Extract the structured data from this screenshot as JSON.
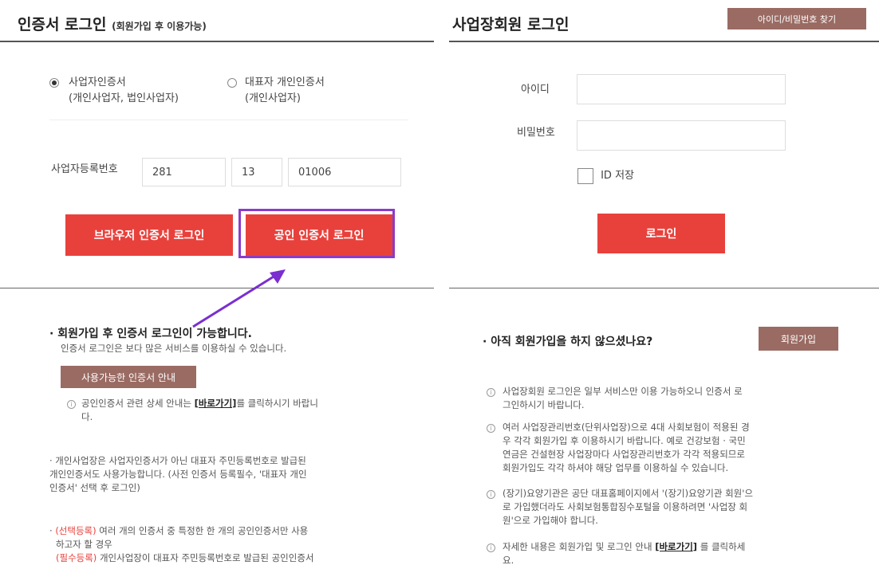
{
  "left": {
    "title": "인증서 로그인",
    "subtitle": "(회원가입 후 이용가능)",
    "radio1": {
      "line1": "사업자인증서",
      "line2": "(개인사업자, 법인사업자)"
    },
    "radio2": {
      "line1": "대표자 개인인증서",
      "line2": "(개인사업자)"
    },
    "bizno_label": "사업자등록번호",
    "bizno": [
      "281",
      "13",
      "01006"
    ],
    "btn_browser": "브라우저 인증서 로그인",
    "btn_public": "공인 인증서 로그인",
    "notice_title": "· 회원가입 후 인증서 로그인이 가능합니다.",
    "notice_sub": "인증서 로그인은 보다 많은 서비스를 이용하실 수 있습니다.",
    "cert_guide_btn": "사용가능한 인증서 안내",
    "info1_a": "공인인증서 관련 상세 안내는 ",
    "info1_link": "[바로가기]",
    "info1_b": "를 클릭하시기 바랍니",
    "info1_c": "다.",
    "info2_l1": "· 개인사업장은 사업자인증서가 아닌 대표자 주민등록번호로 발급된",
    "info2_l2": "개인인증서도 사용가능합니다. (사전 인증서 등록필수, '대표자 개인",
    "info2_l3": "인증서' 선택 후 로그인)",
    "info3_tag": "(선택등록)",
    "info3_l1": " 여러 개의 인증서 중 특정한 한 개의 공인인증서만 사용",
    "info3_l2": "하고자 할 경우",
    "info3_tag2": "(필수등록)",
    "info3_l3": " 개인사업장이 대표자 주민등록번호로 발급된 공인인증서"
  },
  "right": {
    "title": "사업장회원 로그인",
    "find_btn": "아이디/비밀번호 찾기",
    "id_label": "아이디",
    "pw_label": "비밀번호",
    "save_id": "ID 저장",
    "login_btn": "로그인",
    "join_q": "· 아직 회원가입을 하지 않으셨나요?",
    "join_btn": "회원가입",
    "i1_l1": "사업장회원 로그인은 일부 서비스만 이용 가능하오니 인증서 로",
    "i1_l2": "그인하시기 바랍니다.",
    "i2_l1": "여러 사업장관리번호(단위사업장)으로 4대 사회보험이 적용된 경",
    "i2_l2": "우 각각 회원가입 후 이용하시기 바랍니다. 예로 건강보험 · 국민",
    "i2_l3": "연금은 건설현장 사업장마다 사업장관리번호가 각각 적용되므로",
    "i2_l4": "회원가입도 각각 하셔야 해당 업무를 이용하실 수 있습니다.",
    "i3_l1": "(장기)요양기관은 공단 대표홈페이지에서 '(장기)요양기관 회원'으",
    "i3_l2": "로 가입했더라도 사회보험통합징수포털을 이용하려면 '사업장 회",
    "i3_l3": "원'으로 가입해야 합니다.",
    "i4_a": "자세한 내용은 회원가입 및 로그인 안내 ",
    "i4_link": "[바로가기]",
    "i4_b": " 를 클릭하세",
    "i4_c": "요."
  },
  "icons": {
    "info": "info-icon",
    "radio": "radio-icon",
    "checkbox": "checkbox-icon"
  },
  "colors": {
    "accent_red": "#e8413c",
    "brown_button": "#9a6b63",
    "highlight_box": "#8a3cc8",
    "arrow": "#7a2fd0"
  }
}
